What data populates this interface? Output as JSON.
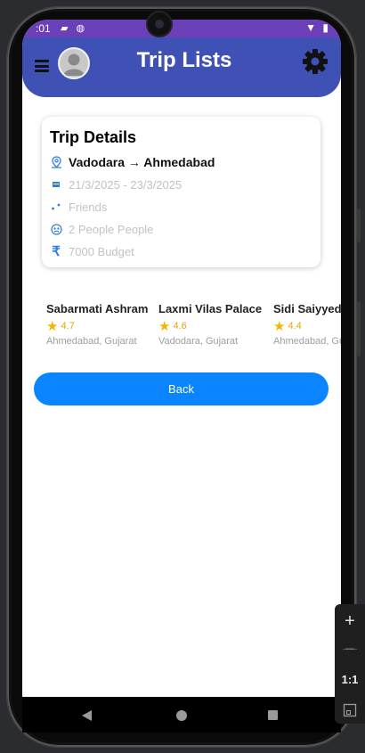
{
  "status_bar": {
    "time": ":01",
    "status_icons": "▰ ◍",
    "right_icons": "▼ ▮"
  },
  "app_bar": {
    "title": "Trip Lists",
    "menu_icon": "hamburger-menu-icon",
    "avatar_icon": "user-avatar-icon",
    "settings_icon": "gear-icon",
    "color": "#3f51b5"
  },
  "trip_card": {
    "title": "Trip Details",
    "route": "Vadodara → Ahmedabad",
    "dates": "21/3/2025 - 23/3/2025",
    "companions": "Friends",
    "people": "2 People People",
    "budget": "7000 Budget",
    "icons": {
      "route": "location-pin-icon",
      "dates": "calendar-icon",
      "companions": "group-icon",
      "people": "people-icon",
      "budget": "rupee-icon"
    }
  },
  "places": [
    {
      "name": "Sabarmati Ashram",
      "rating": "4.7",
      "location": "Ahmedabad, Gujarat"
    },
    {
      "name": "Laxmi Vilas Palace",
      "rating": "4.6",
      "location": "Vadodara, Gujarat"
    },
    {
      "name": "Sidi Saiyyed Mosque",
      "rating": "4.4",
      "location": "Ahmedabad, Gujarat"
    }
  ],
  "back_button": {
    "label": "Back",
    "color": "#0a84ff"
  },
  "nav_bar": {
    "back_icon": "nav-back-icon",
    "home_icon": "nav-home-icon",
    "recents_icon": "nav-recents-icon"
  },
  "emulator_zoom": {
    "plus_label": "+",
    "minus_label": "−",
    "ratio_label": "1:1",
    "fit_icon": "fit-screen-icon"
  }
}
